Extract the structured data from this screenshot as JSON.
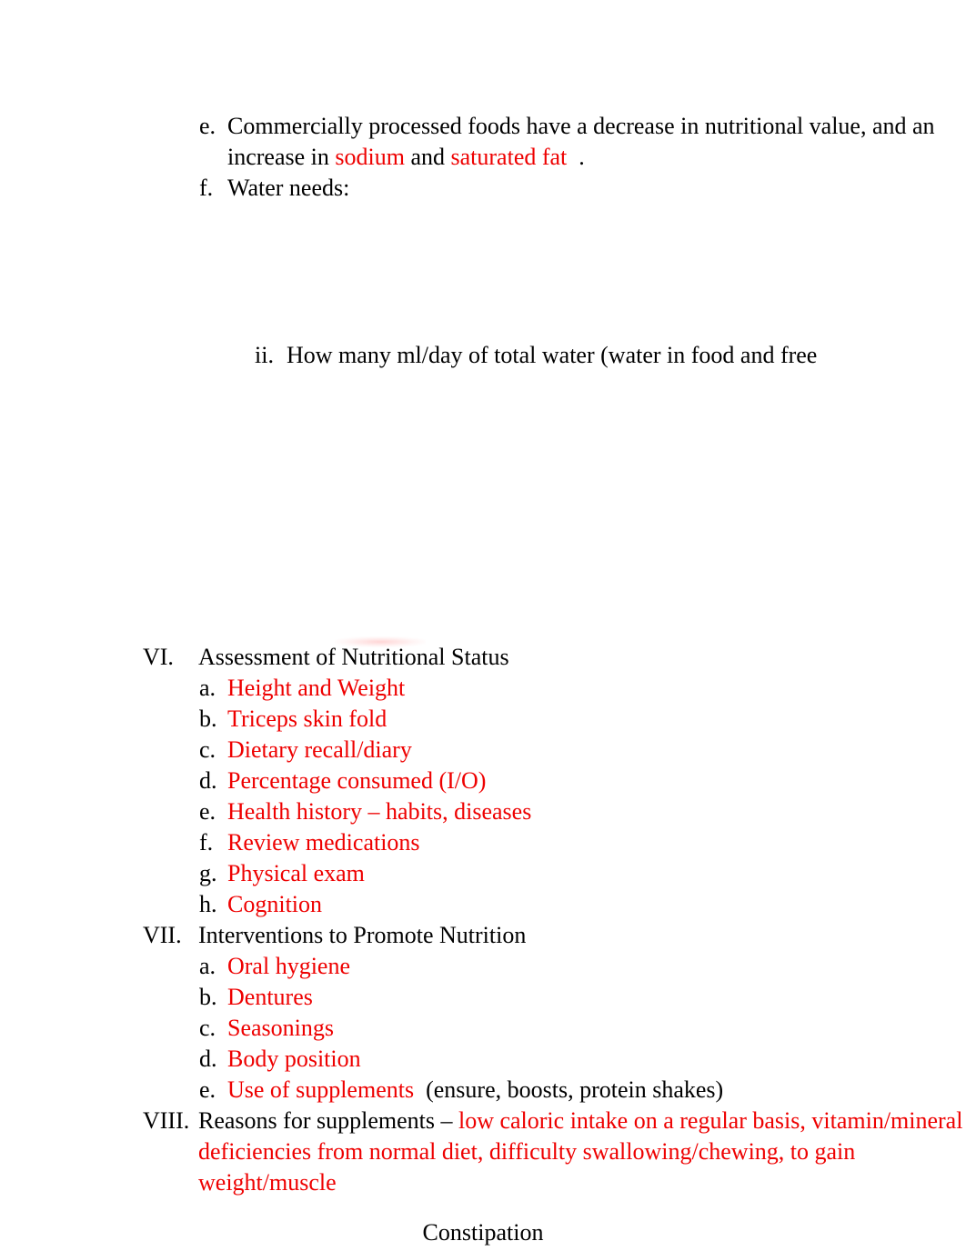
{
  "document": {
    "top_section": {
      "items": [
        {
          "marker": "e.",
          "segments": [
            {
              "text": "Commercially processed foods have a decrease in nutritional value, and an increase in ",
              "color": "black"
            },
            {
              "text": "sodium",
              "color": "red"
            },
            {
              "text": " and ",
              "color": "black"
            },
            {
              "text": "saturated fat",
              "color": "red"
            },
            {
              "text": "  .",
              "color": "black"
            }
          ]
        },
        {
          "marker": "f.",
          "segments": [
            {
              "text": "Water needs:",
              "color": "black"
            }
          ]
        }
      ]
    },
    "sub_question": {
      "marker": "ii.",
      "text": "How many ml/day of total water (water in food and free"
    },
    "outline": [
      {
        "marker": "VI.",
        "title": "Assessment of Nutritional Status",
        "title_color": "black",
        "items": [
          {
            "marker": "a.",
            "text": "Height and Weight",
            "color": "red"
          },
          {
            "marker": "b.",
            "text": "Triceps skin fold",
            "color": "red"
          },
          {
            "marker": "c.",
            "text": "Dietary recall/diary",
            "color": "red"
          },
          {
            "marker": "d.",
            "text": "Percentage consumed (I/O)",
            "color": "red"
          },
          {
            "marker": "e.",
            "text": "Health history – habits, diseases",
            "color": "red"
          },
          {
            "marker": "f.",
            "text": "Review medications",
            "color": "red"
          },
          {
            "marker": "g.",
            "text": "Physical exam",
            "color": "red"
          },
          {
            "marker": "h.",
            "text": "Cognition",
            "color": "red"
          }
        ]
      },
      {
        "marker": "VII.",
        "title": "Interventions to Promote Nutrition",
        "title_color": "black",
        "items": [
          {
            "marker": "a.",
            "text": "Oral hygiene",
            "color": "red"
          },
          {
            "marker": "b.",
            "text": "Dentures",
            "color": "red"
          },
          {
            "marker": "c.",
            "text": "Seasonings",
            "color": "red"
          },
          {
            "marker": "d.",
            "text": "Body position",
            "color": "red"
          },
          {
            "marker": "e.",
            "segments": [
              {
                "text": "Use of supplements",
                "color": "red"
              },
              {
                "text": "  (ensure, boosts, protein shakes)",
                "color": "black"
              }
            ]
          }
        ]
      },
      {
        "marker": "VIII.",
        "segments": [
          {
            "text": "Reasons for supplements – ",
            "color": "black"
          },
          {
            "text": "low caloric intake on a regular basis, vitamin/mineral deficiencies from normal diet, difficulty swallowing/chewing, to gain weight/muscle",
            "color": "red"
          }
        ]
      }
    ],
    "footer": {
      "text": "Constipation"
    },
    "colors": {
      "text_black": "#000000",
      "text_red": "#ee0000",
      "page_background": "#ffffff"
    }
  }
}
